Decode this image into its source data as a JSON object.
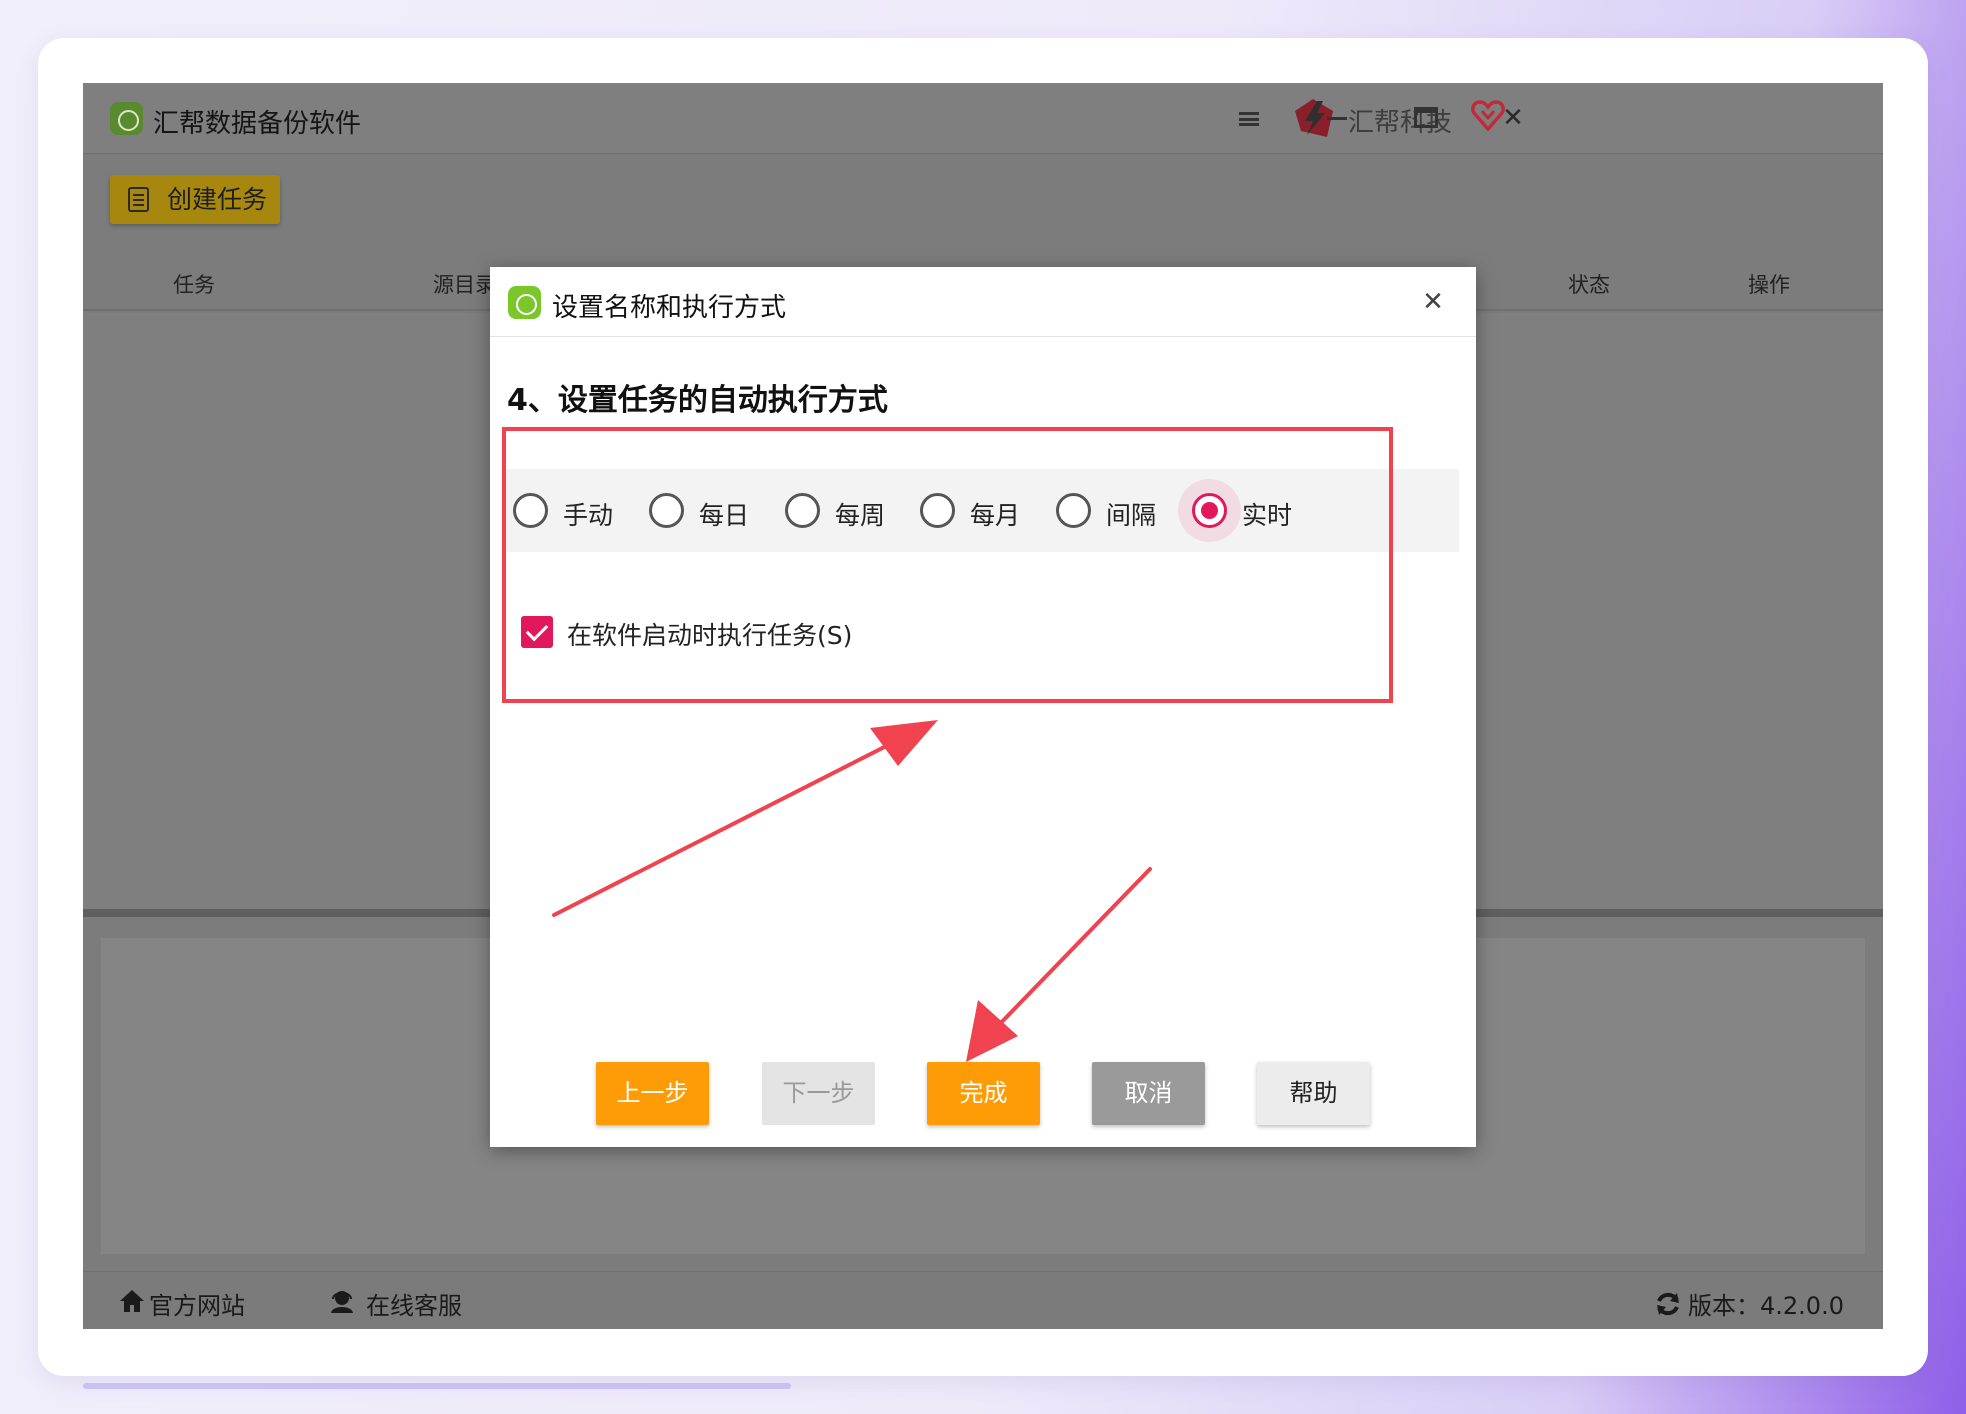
{
  "app": {
    "title": "汇帮数据备份软件",
    "brand_name": "汇帮科技",
    "create_task_label": "创建任务",
    "table_headers": {
      "task": "任务",
      "source": "源目录",
      "status": "状态",
      "action": "操作"
    },
    "footer": {
      "website": "官方网站",
      "support": "在线客服",
      "version": "版本：4.2.0.0"
    }
  },
  "dialog": {
    "title": "设置名称和执行方式",
    "close_symbol": "✕",
    "step_title": "4、设置任务的自动执行方式",
    "modes": [
      {
        "label": "手动",
        "checked": false
      },
      {
        "label": "每日",
        "checked": false
      },
      {
        "label": "每周",
        "checked": false
      },
      {
        "label": "每月",
        "checked": false
      },
      {
        "label": "间隔",
        "checked": false
      },
      {
        "label": "实时",
        "checked": true
      }
    ],
    "run_on_start": {
      "label": "在软件启动时执行任务(S)",
      "checked": true
    },
    "buttons": {
      "prev": "上一步",
      "next": "下一步",
      "finish": "完成",
      "cancel": "取消",
      "help": "帮助"
    }
  },
  "window_controls": {
    "close_symbol": "✕"
  },
  "colors": {
    "accent": "#e3175b",
    "orange": "#fd9c06",
    "annotation_red": "#f0424f"
  }
}
